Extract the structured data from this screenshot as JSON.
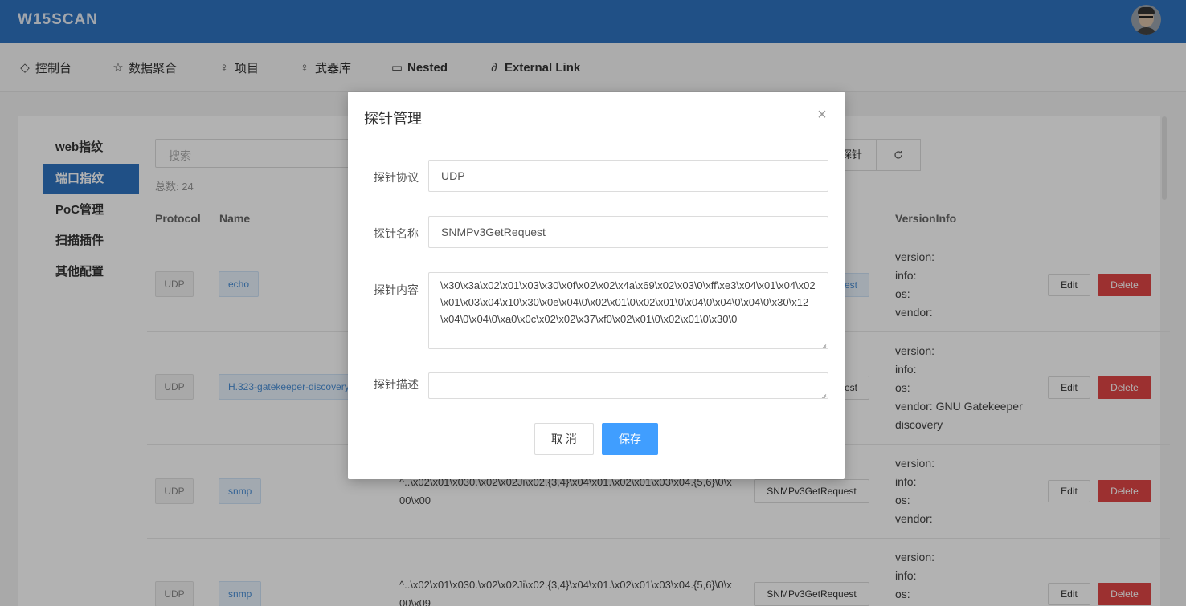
{
  "app": {
    "title": "W15SCAN"
  },
  "nav": [
    {
      "label": "控制台",
      "icon": "dashboard-icon",
      "glyph": "◇"
    },
    {
      "label": "数据聚合",
      "icon": "star-icon",
      "glyph": "☆"
    },
    {
      "label": "项目",
      "icon": "bulb-icon",
      "glyph": "♀"
    },
    {
      "label": "武器库",
      "icon": "bulb-icon",
      "glyph": "♀"
    },
    {
      "label": "Nested",
      "icon": "window-icon",
      "glyph": "▭"
    },
    {
      "label": "External Link",
      "icon": "link-icon",
      "glyph": "∂"
    }
  ],
  "sidebar": [
    {
      "label": "web指纹",
      "active": false
    },
    {
      "label": "端口指纹",
      "active": true
    },
    {
      "label": "PoC管理",
      "active": false
    },
    {
      "label": "扫描插件",
      "active": false
    },
    {
      "label": "其他配置",
      "active": false
    }
  ],
  "toolbar": {
    "search_placeholder": "搜索",
    "probe_button": "探针",
    "refresh_icon": "refresh-icon",
    "total": "总数: 24"
  },
  "table": {
    "headers": {
      "protocol": "Protocol",
      "name": "Name",
      "versioninfo": "VersionInfo"
    },
    "rows": [
      {
        "protocol": "UDP",
        "name": "echo",
        "match": "",
        "probe": "est",
        "vinfo": [
          "version:",
          "info:",
          "os:",
          "vendor:"
        ]
      },
      {
        "protocol": "UDP",
        "name": "H.323-gatekeeper-discovery",
        "match": "",
        "probe": "est",
        "vinfo": [
          "version:",
          "info:",
          "os:",
          "vendor: GNU Gatekeeper discovery"
        ]
      },
      {
        "protocol": "UDP",
        "name": "snmp",
        "match": "^..\\x02\\x01\\x030.\\x02\\x02Ji\\x02.{3,4}\\x04\\x01.\\x02\\x01\\x03\\x04.{5,6}\\0\\x00\\x00",
        "probe": "SNMPv3GetRequest",
        "vinfo": [
          "version:",
          "info:",
          "os:",
          "vendor:"
        ]
      },
      {
        "protocol": "UDP",
        "name": "snmp",
        "match": "^..\\x02\\x01\\x030.\\x02\\x02Ji\\x02.{3,4}\\x04\\x01.\\x02\\x01\\x03\\x04.{5,6}\\0\\x00\\x09",
        "probe": "SNMPv3GetRequest",
        "vinfo": [
          "version:",
          "info:",
          "os:"
        ]
      }
    ],
    "edit_label": "Edit",
    "delete_label": "Delete"
  },
  "modal": {
    "title": "探针管理",
    "close": "×",
    "fields": {
      "protocol_label": "探针协议",
      "protocol_value": "UDP",
      "name_label": "探针名称",
      "name_value": "SNMPv3GetRequest",
      "content_label": "探针内容",
      "content_value": "\\x30\\x3a\\x02\\x01\\x03\\x30\\x0f\\x02\\x02\\x4a\\x69\\x02\\x03\\0\\xff\\xe3\\x04\\x01\\x04\\x02\\x01\\x03\\x04\\x10\\x30\\x0e\\x04\\0\\x02\\x01\\0\\x02\\x01\\0\\x04\\0\\x04\\0\\x04\\0\\x30\\x12\\x04\\0\\x04\\0\\xa0\\x0c\\x02\\x02\\x37\\xf0\\x02\\x01\\0\\x02\\x01\\0\\x30\\0",
      "desc_label": "探针描述",
      "desc_value": ""
    },
    "cancel_label": "取 消",
    "save_label": "保存"
  }
}
